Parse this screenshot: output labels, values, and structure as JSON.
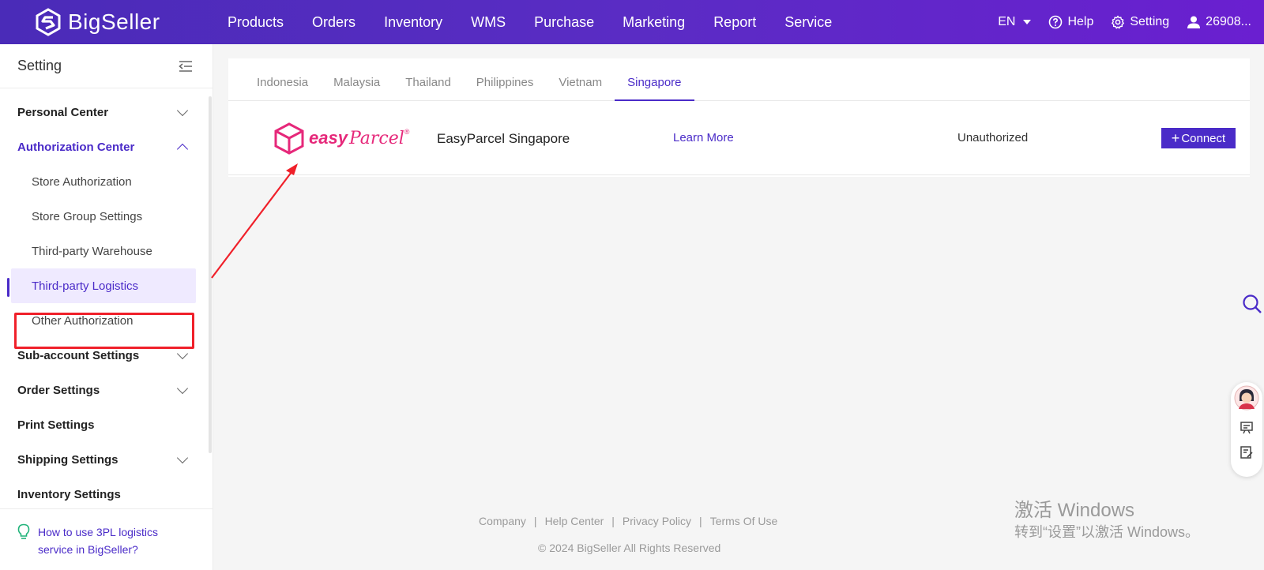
{
  "brand": {
    "name": "BigSeller"
  },
  "nav": {
    "items": [
      "Products",
      "Orders",
      "Inventory",
      "WMS",
      "Purchase",
      "Marketing",
      "Report",
      "Service"
    ]
  },
  "topright": {
    "language": "EN",
    "help": "Help",
    "setting": "Setting",
    "user": "26908..."
  },
  "sidebar": {
    "title": "Setting",
    "groups": {
      "personal": "Personal Center",
      "authorization": "Authorization Center",
      "subaccount": "Sub-account Settings",
      "order": "Order Settings",
      "print": "Print Settings",
      "shipping": "Shipping Settings",
      "inventory": "Inventory Settings"
    },
    "auth_items": [
      "Store Authorization",
      "Store Group Settings",
      "Third-party Warehouse",
      "Third-party Logistics",
      "Other Authorization"
    ],
    "footer_help": "How to use 3PL logistics service in BigSeller?"
  },
  "tabs": [
    "Indonesia",
    "Malaysia",
    "Thailand",
    "Philippines",
    "Vietnam",
    "Singapore"
  ],
  "active_tab": "Singapore",
  "carrier": {
    "logo_text": "easy",
    "logo_script": "Parcel",
    "name": "EasyParcel Singapore",
    "learn_more": "Learn More",
    "status": "Unauthorized",
    "connect_label": "Connect"
  },
  "footer": {
    "links": [
      "Company",
      "Help Center",
      "Privacy Policy",
      "Terms Of Use"
    ],
    "copyright": "© 2024 BigSeller All Rights Reserved"
  },
  "watermark": {
    "line1": "激活 Windows",
    "line2": "转到“设置”以激活 Windows。"
  },
  "colors": {
    "brand": "#4a2bc8",
    "highlight": "#f0202a",
    "logo_pink": "#e6287a"
  }
}
